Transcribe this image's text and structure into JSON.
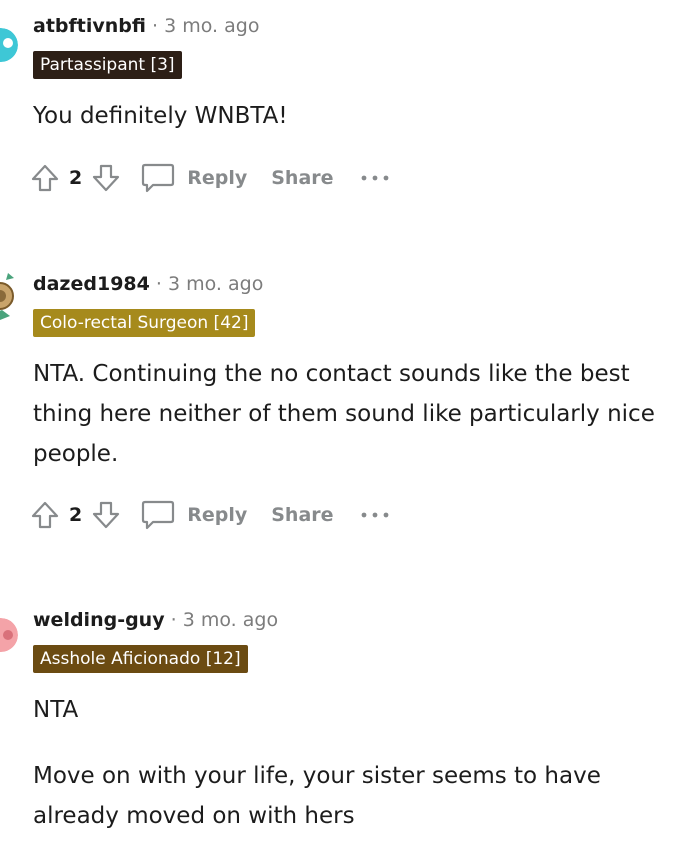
{
  "comments": [
    {
      "username": "atbftivnbfi",
      "separator": "·",
      "time": "3 mo. ago",
      "flair": "Partassipant [3]",
      "flair_color": "#2d1f16",
      "avatar_color": "#3ec7d6",
      "paragraphs": [
        "You definitely WNBTA!"
      ],
      "votes": "2",
      "reply_label": "Reply",
      "share_label": "Share"
    },
    {
      "username": "dazed1984",
      "separator": "·",
      "time": "3 mo. ago",
      "flair": "Colo-rectal Surgeon [42]",
      "flair_color": "#a68a1c",
      "avatar_color": "#c9a46b",
      "paragraphs": [
        "NTA. Continuing the no contact sounds like the best thing here neither of them sound like particularly nice people."
      ],
      "votes": "2",
      "reply_label": "Reply",
      "share_label": "Share"
    },
    {
      "username": "welding-guy",
      "separator": "·",
      "time": "3 mo. ago",
      "flair": "Asshole Aficionado [12]",
      "flair_color": "#6b4b12",
      "avatar_color": "#f4a3a8",
      "paragraphs": [
        "NTA",
        "Move on with your life, your sister seems to have already moved on with hers"
      ]
    }
  ]
}
